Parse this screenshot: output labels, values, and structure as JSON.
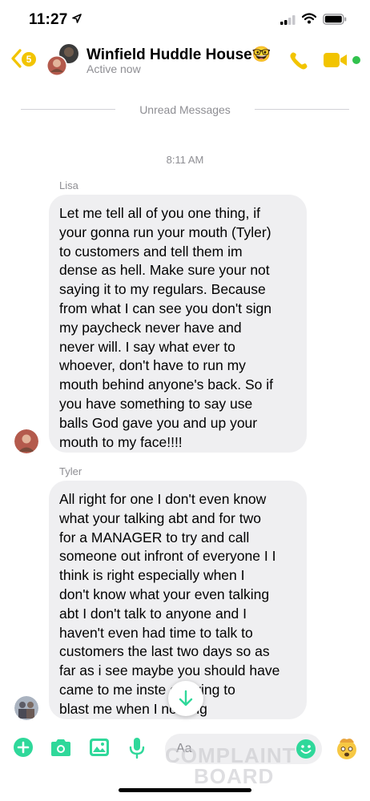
{
  "status_bar": {
    "time": "11:27"
  },
  "header": {
    "back_count": "5",
    "title": "Winfield Huddle House🤓",
    "subtitle": "Active now"
  },
  "divider": {
    "unread_label": "Unread Messages"
  },
  "timestamp": "8:11 AM",
  "messages": [
    {
      "sender": "Lisa",
      "text": "Let me tell all of you one thing, if\nyour gonna run your mouth (Tyler)\nto customers and tell them im\ndense as hell. Make sure your not\nsaying it to my regulars. Because\nfrom what I can see you don't sign\nmy paycheck never have and\nnever will. I say what ever to\nwhoever, don't have to run my\nmouth behind anyone's back. So if\nyou have something to say use\nballs God gave you and up your\nmouth to my face!!!!"
    },
    {
      "sender": "Tyler",
      "text": "All right for one I don't even know\nwhat your talking abt and for two\nfor a MANAGER to try and call\nsomeone out infront of everyone I I\nthink is right especially when I\ndon't know what your even talking\nabt I don't talk to anyone and I\nhaven't even had time to talk to\ncustomers the last two days so as\nfar as i see maybe you should have\ncame to me inste  of trying to\nblast me when I     nothing"
    }
  ],
  "composer": {
    "placeholder": "Aa"
  },
  "watermark": {
    "line1": "COMPLAINT",
    "line2": "BOARD"
  },
  "colors": {
    "accent": "#f2c400",
    "composer_icons": "#2fd89a",
    "bubble": "#efeff1",
    "active": "#31c24d"
  },
  "icons": [
    "location-arrow-icon",
    "signal-icon",
    "wifi-icon",
    "battery-icon",
    "back-chevron-icon",
    "phone-icon",
    "video-icon",
    "plus-icon",
    "camera-icon",
    "image-icon",
    "microphone-icon",
    "emoji-icon",
    "quick-reaction-icon",
    "arrow-down-icon"
  ]
}
